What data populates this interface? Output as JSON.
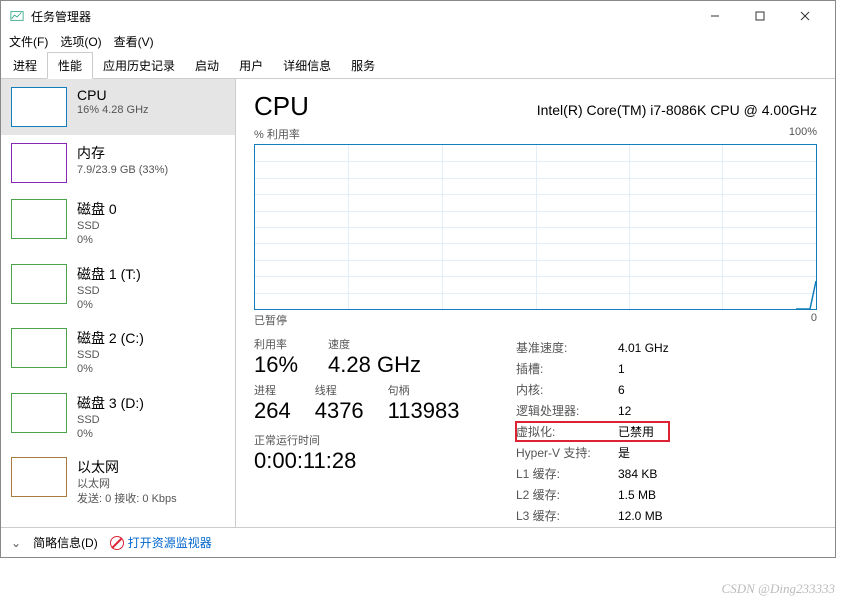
{
  "window": {
    "title": "任务管理器",
    "controls": {
      "min": "—",
      "max": "▢",
      "close": "✕"
    }
  },
  "menu": {
    "file": "文件(F)",
    "options": "选项(O)",
    "view": "查看(V)"
  },
  "tabs": {
    "processes": "进程",
    "performance": "性能",
    "apphistory": "应用历史记录",
    "startup": "启动",
    "users": "用户",
    "details": "详细信息",
    "services": "服务"
  },
  "sidebar": [
    {
      "id": "cpu",
      "name": "CPU",
      "sub": "16% 4.28 GHz",
      "kind": "cpu",
      "selected": true
    },
    {
      "id": "mem",
      "name": "内存",
      "sub": "7.9/23.9 GB (33%)",
      "kind": "mem"
    },
    {
      "id": "disk0",
      "name": "磁盘 0",
      "sub1": "SSD",
      "sub2": "0%",
      "kind": "disk"
    },
    {
      "id": "disk1",
      "name": "磁盘 1 (T:)",
      "sub1": "SSD",
      "sub2": "0%",
      "kind": "disk"
    },
    {
      "id": "disk2",
      "name": "磁盘 2 (C:)",
      "sub1": "SSD",
      "sub2": "0%",
      "kind": "disk"
    },
    {
      "id": "disk3",
      "name": "磁盘 3 (D:)",
      "sub1": "SSD",
      "sub2": "0%",
      "kind": "disk"
    },
    {
      "id": "eth",
      "name": "以太网",
      "sub1": "以太网",
      "sub2": "发送: 0 接收: 0 Kbps",
      "kind": "net"
    }
  ],
  "main": {
    "title": "CPU",
    "model": "Intel(R) Core(TM) i7-8086K CPU @ 4.00GHz",
    "chart": {
      "ylabel": "% 利用率",
      "ymax": "100%",
      "paused": "已暂停",
      "xright": "0"
    },
    "left": {
      "util_l": "利用率",
      "util_v": "16%",
      "speed_l": "速度",
      "speed_v": "4.28 GHz",
      "proc_l": "进程",
      "proc_v": "264",
      "thr_l": "线程",
      "thr_v": "4376",
      "hnd_l": "句柄",
      "hnd_v": "113983",
      "up_l": "正常运行时间",
      "up_v": "0:00:11:28"
    },
    "right": {
      "base_l": "基准速度:",
      "base_v": "4.01 GHz",
      "sock_l": "插槽:",
      "sock_v": "1",
      "core_l": "内核:",
      "core_v": "6",
      "lp_l": "逻辑处理器:",
      "lp_v": "12",
      "virt_l": "虚拟化:",
      "virt_v": "已禁用",
      "hv_l": "Hyper-V 支持:",
      "hv_v": "是",
      "l1_l": "L1 缓存:",
      "l1_v": "384 KB",
      "l2_l": "L2 缓存:",
      "l2_v": "1.5 MB",
      "l3_l": "L3 缓存:",
      "l3_v": "12.0 MB"
    }
  },
  "footer": {
    "fewer": "简略信息(D)",
    "resmon": "打开资源监视器"
  },
  "watermark": "CSDN @Ding233333",
  "chart_data": {
    "type": "line",
    "title": "% 利用率",
    "ylabel": "% 利用率",
    "ylim": [
      0,
      100
    ],
    "note": "chart paused; single small spike at right edge",
    "series": [
      {
        "name": "CPU",
        "values": [
          16
        ]
      }
    ]
  }
}
